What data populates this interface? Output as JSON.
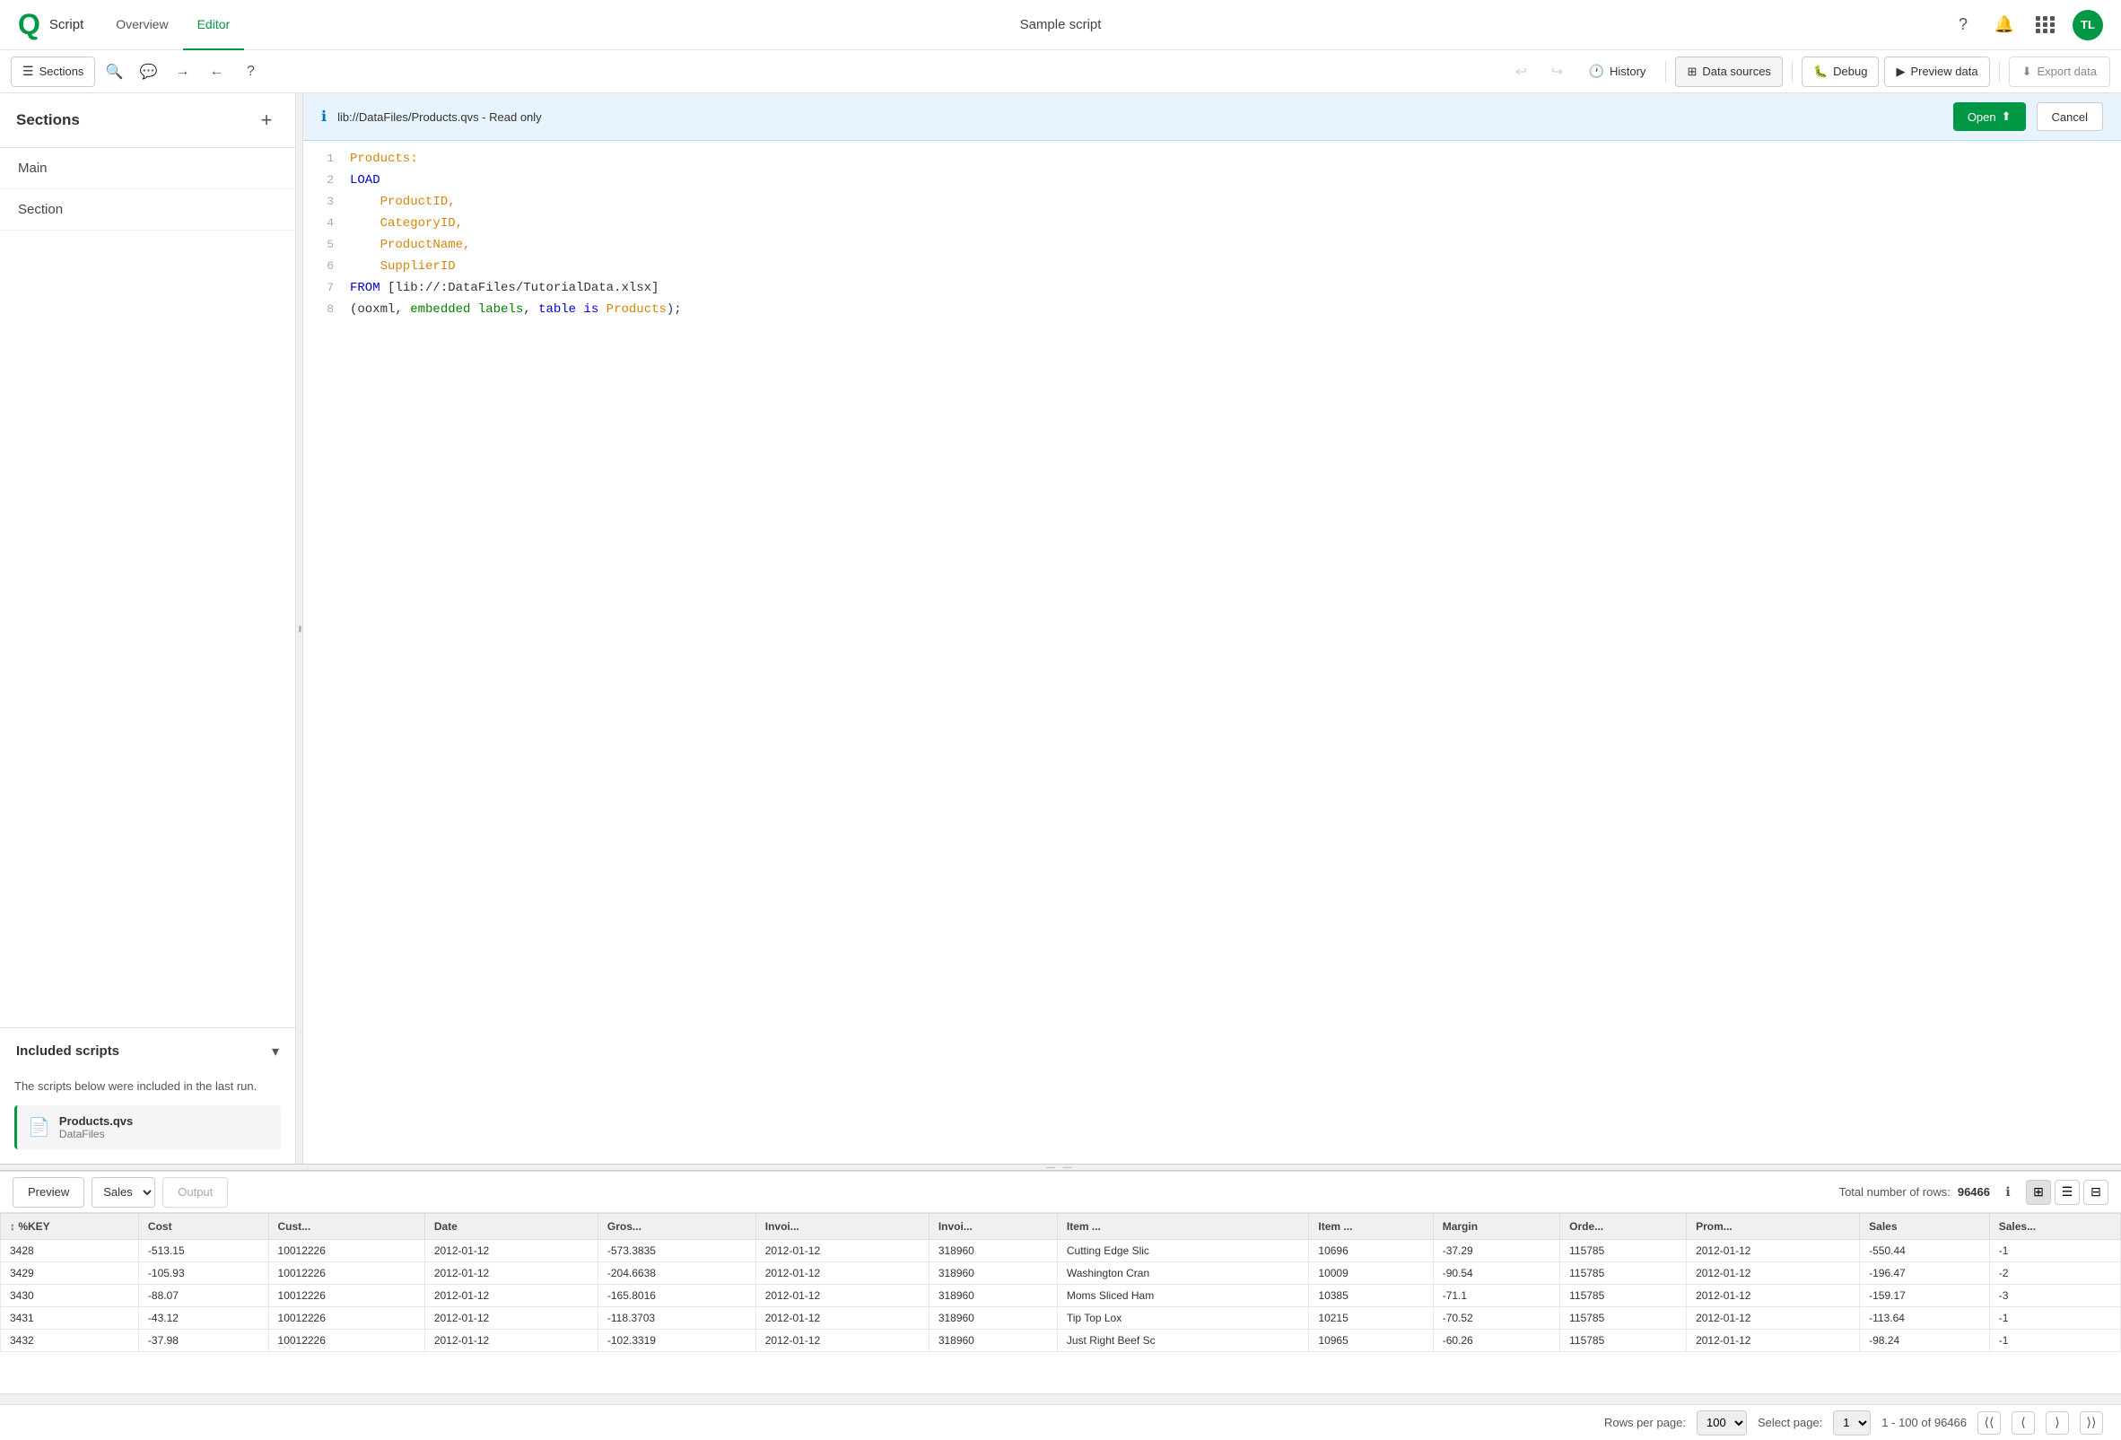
{
  "topNav": {
    "logo": "Qlik",
    "appTitle": "Script",
    "tabs": [
      {
        "id": "overview",
        "label": "Overview",
        "active": false
      },
      {
        "id": "editor",
        "label": "Editor",
        "active": true
      }
    ],
    "centerTitle": "Sample script",
    "avatarInitials": "TL"
  },
  "toolbar": {
    "sections_label": "Sections",
    "history_label": "History",
    "data_sources_label": "Data sources",
    "debug_label": "Debug",
    "preview_data_label": "Preview data",
    "export_data_label": "Export data"
  },
  "readonlyBanner": {
    "text": "lib://DataFiles/Products.qvs - Read only",
    "open_label": "Open",
    "cancel_label": "Cancel"
  },
  "sidebar": {
    "title": "Sections",
    "items": [
      {
        "label": "Main"
      },
      {
        "label": "Section"
      }
    ]
  },
  "codeLines": [
    {
      "num": 1,
      "content": "Products:",
      "type": "label"
    },
    {
      "num": 2,
      "content": "LOAD",
      "type": "keyword-blue"
    },
    {
      "num": 3,
      "content": "    ProductID,",
      "type": "field"
    },
    {
      "num": 4,
      "content": "    CategoryID,",
      "type": "field"
    },
    {
      "num": 5,
      "content": "    ProductName,",
      "type": "field"
    },
    {
      "num": 6,
      "content": "    SupplierID",
      "type": "field"
    },
    {
      "num": 7,
      "content": "FROM [lib://:DataFiles/TutorialData.xlsx]",
      "type": "from"
    },
    {
      "num": 8,
      "content": "(ooxml, embedded labels, table is Products);",
      "type": "params"
    }
  ],
  "includedScripts": {
    "title": "Included scripts",
    "description": "The scripts below were included in the last run.",
    "files": [
      {
        "name": "Products.qvs",
        "path": "DataFiles"
      }
    ]
  },
  "preview": {
    "label": "Preview",
    "dropdown_value": "Sales",
    "output_label": "Output",
    "total_rows_label": "Total number of rows:",
    "total_rows": "96466"
  },
  "table": {
    "columns": [
      "%KEY",
      "Cost",
      "Cust...",
      "Date",
      "Gros...",
      "Invoi...",
      "Invoi...",
      "Item ...",
      "Item ...",
      "Margin",
      "Orde...",
      "Prom...",
      "Sales",
      "Sales..."
    ],
    "rows": [
      [
        "3428",
        "-513.15",
        "10012226",
        "2012-01-12",
        "-573.3835",
        "2012-01-12",
        "318960",
        "Cutting Edge Slic",
        "10696",
        "-37.29",
        "115785",
        "2012-01-12",
        "-550.44",
        "-1"
      ],
      [
        "3429",
        "-105.93",
        "10012226",
        "2012-01-12",
        "-204.6638",
        "2012-01-12",
        "318960",
        "Washington Cran",
        "10009",
        "-90.54",
        "115785",
        "2012-01-12",
        "-196.47",
        "-2"
      ],
      [
        "3430",
        "-88.07",
        "10012226",
        "2012-01-12",
        "-165.8016",
        "2012-01-12",
        "318960",
        "Moms Sliced Ham",
        "10385",
        "-71.1",
        "115785",
        "2012-01-12",
        "-159.17",
        "-3"
      ],
      [
        "3431",
        "-43.12",
        "10012226",
        "2012-01-12",
        "-118.3703",
        "2012-01-12",
        "318960",
        "Tip Top Lox",
        "10215",
        "-70.52",
        "115785",
        "2012-01-12",
        "-113.64",
        "-1"
      ],
      [
        "3432",
        "-37.98",
        "10012226",
        "2012-01-12",
        "-102.3319",
        "2012-01-12",
        "318960",
        "Just Right Beef Sc",
        "10965",
        "-60.26",
        "115785",
        "2012-01-12",
        "-98.24",
        "-1"
      ]
    ]
  },
  "pagination": {
    "rows_per_page_label": "Rows per page:",
    "rows_per_page_value": "100",
    "select_page_label": "Select page:",
    "select_page_value": "1",
    "range_text": "1 - 100 of 96466"
  }
}
